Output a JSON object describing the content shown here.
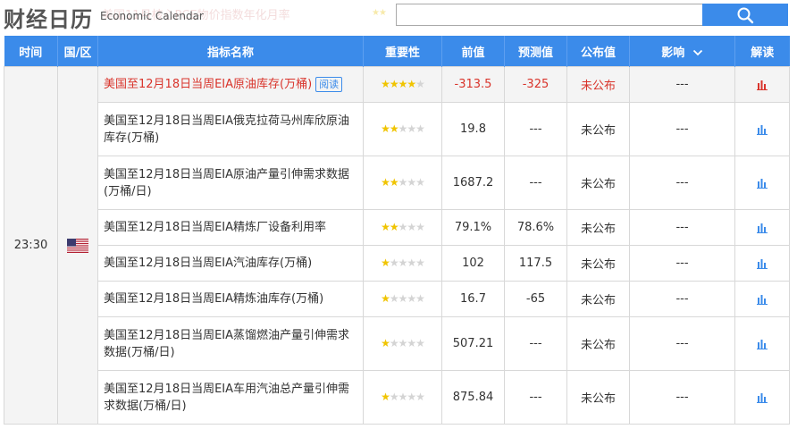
{
  "header": {
    "title_cn": "财经日历",
    "title_en": "Economic Calendar",
    "ghost_text": "美国11月核心PCE物价指数年化月率",
    "search_value": "",
    "search_icon": "search-icon"
  },
  "colors": {
    "accent": "#3b8bea",
    "highlight_text": "#d9342b",
    "star": "#f0c400"
  },
  "columns": [
    "时间",
    "国/区",
    "指标名称",
    "重要性",
    "前值",
    "预测值",
    "公布值",
    "影响",
    "解读"
  ],
  "group": {
    "time": "23:30",
    "country_icon": "us-flag-icon"
  },
  "rows": [
    {
      "name": "美国至12月18日当周EIA原油库存(万桶)",
      "tag": "阅读",
      "stars": 4,
      "prev": "-313.5",
      "forecast": "-325",
      "actual": "未公布",
      "impact": "---",
      "highlight": true
    },
    {
      "name": "美国至12月18日当周EIA俄克拉荷马州库欣原油库存(万桶)",
      "stars": 2,
      "prev": "19.8",
      "forecast": "---",
      "actual": "未公布",
      "impact": "---"
    },
    {
      "name": "美国至12月18日当周EIA原油产量引伸需求数据(万桶/日)",
      "stars": 2,
      "prev": "1687.2",
      "forecast": "---",
      "actual": "未公布",
      "impact": "---"
    },
    {
      "name": "美国至12月18日当周EIA精炼厂设备利用率",
      "stars": 2,
      "prev": "79.1%",
      "forecast": "78.6%",
      "actual": "未公布",
      "impact": "---"
    },
    {
      "name": "美国至12月18日当周EIA汽油库存(万桶)",
      "stars": 1,
      "prev": "102",
      "forecast": "117.5",
      "actual": "未公布",
      "impact": "---"
    },
    {
      "name": "美国至12月18日当周EIA精炼油库存(万桶)",
      "stars": 1,
      "prev": "16.7",
      "forecast": "-65",
      "actual": "未公布",
      "impact": "---"
    },
    {
      "name": "美国至12月18日当周EIA蒸馏燃油产量引伸需求数据(万桶/日)",
      "stars": 1,
      "prev": "507.21",
      "forecast": "---",
      "actual": "未公布",
      "impact": "---"
    },
    {
      "name": "美国至12月18日当周EIA车用汽油总产量引伸需求数据(万桶/日)",
      "stars": 1,
      "prev": "875.84",
      "forecast": "---",
      "actual": "未公布",
      "impact": "---"
    }
  ]
}
